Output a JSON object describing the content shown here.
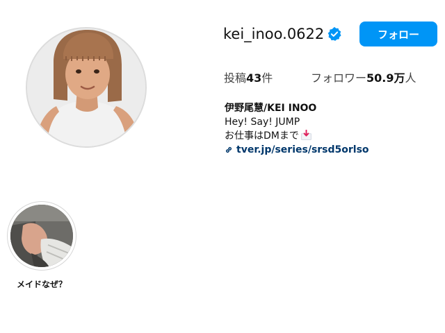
{
  "profile": {
    "username": "kei_inoo.0622",
    "follow_label": "フォロー",
    "stats": {
      "posts_label": "投稿",
      "posts_count": "43",
      "posts_unit": "件",
      "followers_label": "フォロワー",
      "followers_count": "50.9万",
      "followers_unit": "人"
    },
    "bio": {
      "name": "伊野尾慧/KEI INOO",
      "line1": "Hey! Say! JUMP",
      "line2": "お仕事はDMまで",
      "link": "tver.jp/series/srsd5orlso"
    }
  },
  "highlights": [
    {
      "label": "メイドなぜ？"
    }
  ],
  "icons": {
    "verified": "verified-badge-icon",
    "link": "link-chain-icon",
    "mail": "inbox-mail-icon"
  },
  "colors": {
    "accent": "#0095f6",
    "link": "#00376b"
  }
}
